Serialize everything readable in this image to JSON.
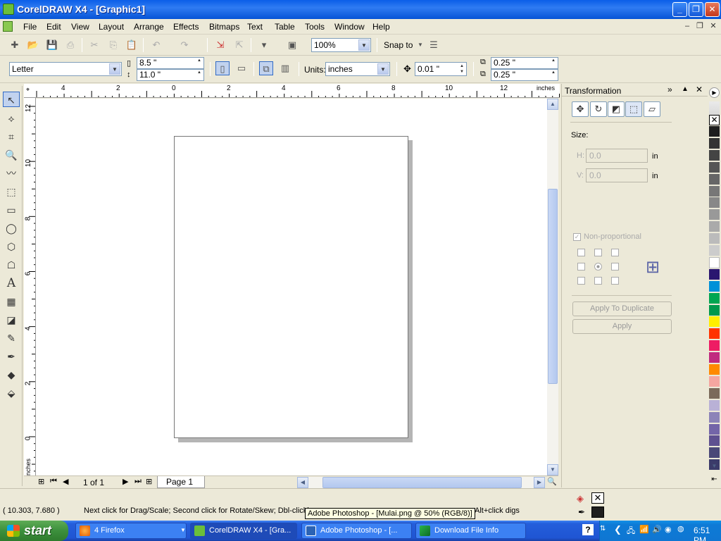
{
  "window": {
    "title": "CorelDRAW X4 - [Graphic1]"
  },
  "menubar": {
    "items": [
      "File",
      "Edit",
      "View",
      "Layout",
      "Arrange",
      "Effects",
      "Bitmaps",
      "Text",
      "Table",
      "Tools",
      "Window",
      "Help"
    ]
  },
  "standard_toolbar": {
    "zoom": "100%",
    "snap_label": "Snap to"
  },
  "property_bar": {
    "paper_size": "Letter",
    "width": "8.5 \"",
    "height": "11.0 \"",
    "units_label": "Units:",
    "units": "inches",
    "nudge": "0.01 \"",
    "dup_x": "0.25 \"",
    "dup_y": "0.25 \""
  },
  "rulers": {
    "unit_label": "inches",
    "corner_label": "inches",
    "horizontal_labels": [
      "4",
      "2",
      "0",
      "2",
      "4",
      "6",
      "8",
      "10",
      "12"
    ],
    "vertical_labels": [
      "12",
      "10",
      "8",
      "6",
      "4",
      "2",
      "0"
    ]
  },
  "document": {
    "page_count": "1 of 1",
    "page_tab": "Page 1"
  },
  "docker": {
    "title": "Transformation",
    "size_label": "Size:",
    "h_label": "H:",
    "h_value": "0.0",
    "v_label": "V:",
    "v_value": "0.0",
    "unit": "in",
    "nonprop_label": "Non-proportional",
    "apply_dup_label": "Apply To Duplicate",
    "apply_label": "Apply"
  },
  "palette": {
    "colors": [
      "#1e1e1e",
      "#333333",
      "#444444",
      "#555555",
      "#666666",
      "#777777",
      "#888888",
      "#999999",
      "#aaaaaa",
      "#bbbbbb",
      "#cccccc",
      "#ffffff",
      "#2a1670",
      "#0091d8",
      "#00a651",
      "#00994c",
      "#ffef00",
      "#ff3300",
      "#ee1c64",
      "#c02a7f",
      "#ff8a00",
      "#f5a6a0",
      "#7b6a5a",
      "#b9b1d6",
      "#8c84b8",
      "#7365a8",
      "#5e5090",
      "#4a4878",
      "#3b3b6a"
    ]
  },
  "statusbar": {
    "coords": "( 10.303, 7.680 )",
    "hint": "Next click for Drag/Scale; Second click for Rotate/Skew; Dbl-clicking",
    "hint_tail": "Alt+click digs",
    "tooltip": "Adobe Photoshop - [Mulai.png @ 50% (RGB/8)]"
  },
  "taskbar": {
    "start_label": "start",
    "tasks": [
      {
        "label": "4 Firefox"
      },
      {
        "label": "CorelDRAW X4 - [Gra..."
      },
      {
        "label": "Adobe Photoshop - [..."
      },
      {
        "label": "Download File Info"
      }
    ],
    "clock": "6:51 PM"
  }
}
